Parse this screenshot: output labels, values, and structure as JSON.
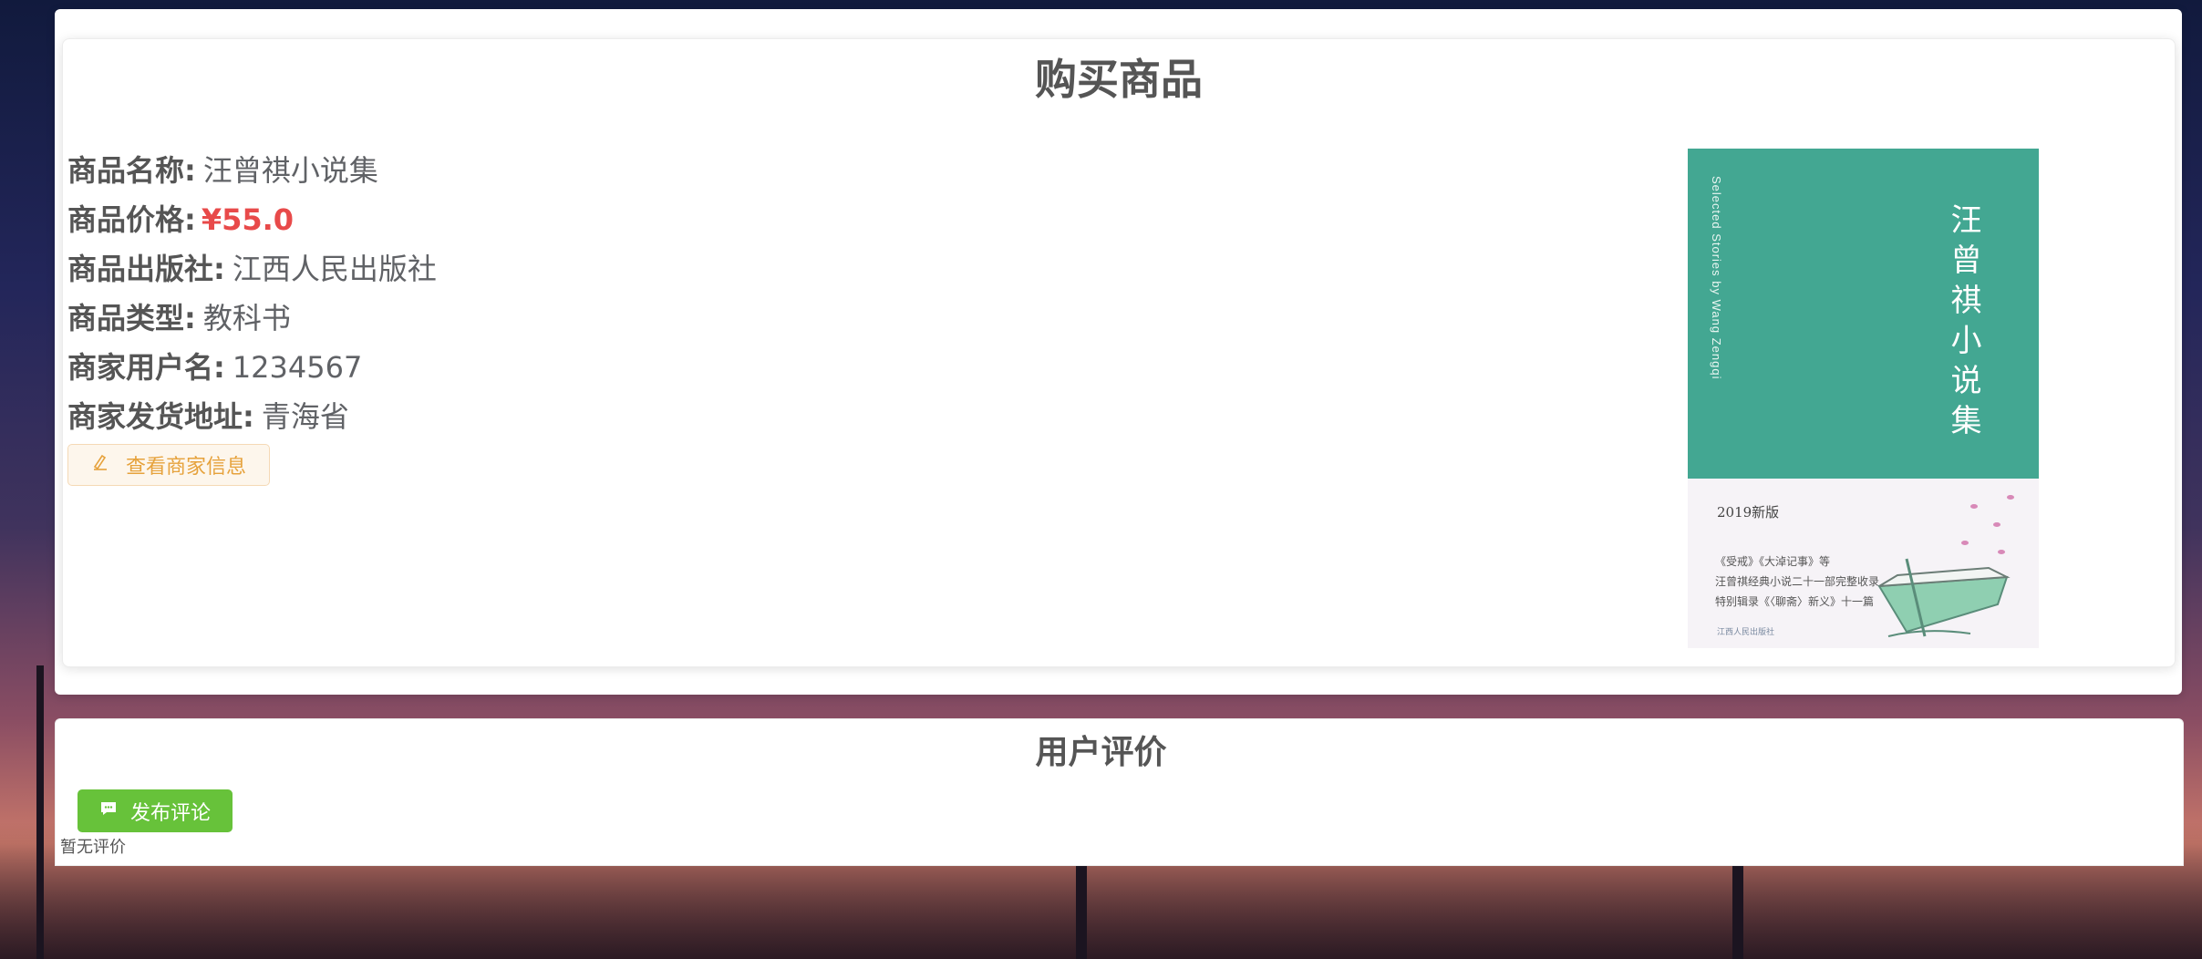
{
  "page": {
    "title": "购买商品"
  },
  "product": {
    "name_label": "商品名称:",
    "name": "汪曾祺小说集",
    "price_label": "商品价格:",
    "price": "¥55.0",
    "publisher_label": "商品出版社:",
    "publisher": "江西人民出版社",
    "type_label": "商品类型:",
    "type": "教科书",
    "merchant_label": "商家用户名:",
    "merchant": "1234567",
    "address_label": "商家发货地址:",
    "address": "青海省",
    "merchant_button": "查看商家信息"
  },
  "cover": {
    "title_cn": "汪曾祺小说集",
    "title_en": "Selected Stories by Wang Zengqi",
    "edition": "2019新版",
    "lines": [
      "《受戒》《大淖记事》等",
      "汪曾祺经典小说二十一部完整收录",
      "特别辑录《〈聊斋〉新义》十一篇"
    ],
    "publisher_logo": "江西人民出版社"
  },
  "reviews": {
    "title": "用户评价",
    "post_button": "发布评论",
    "empty_text": "暂无评价"
  },
  "colors": {
    "price": "#e84a4a",
    "warning": "#e6a23c",
    "success": "#67c23a",
    "cover_green": "#43a792"
  }
}
